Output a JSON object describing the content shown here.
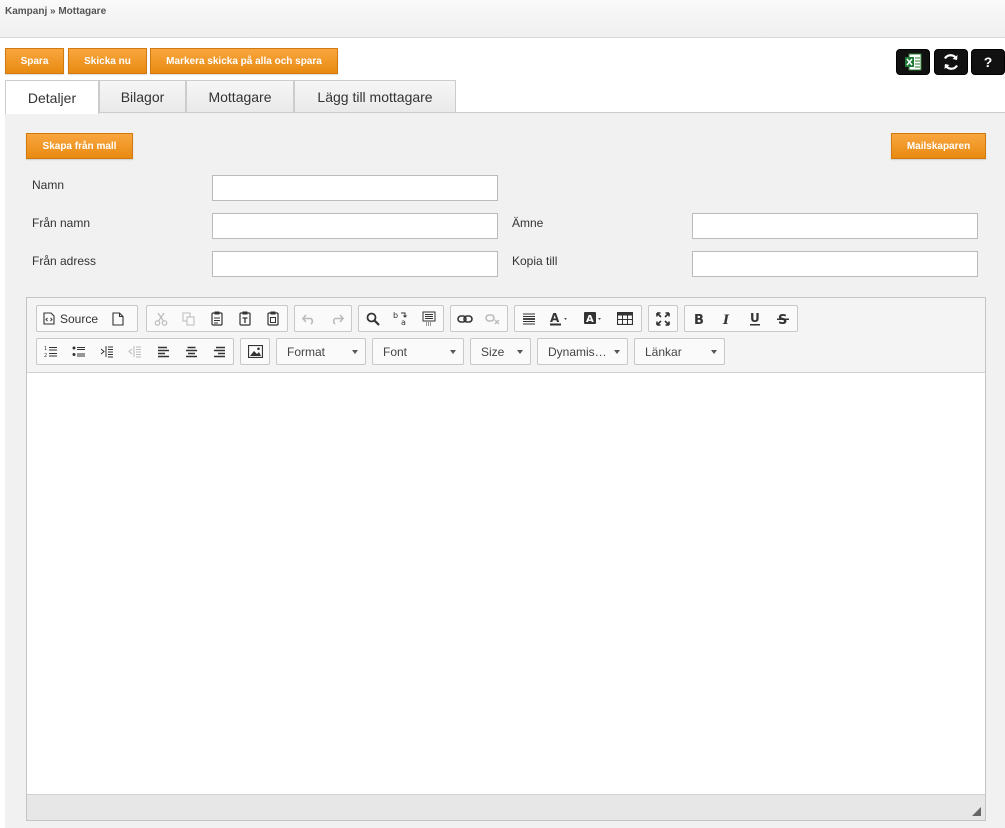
{
  "breadcrumb": "Kampanj » Mottagare",
  "actions": {
    "save": "Spara",
    "send_now": "Skicka nu",
    "mark_send_all": "Markera skicka på alla och spara"
  },
  "tools": {
    "help": "?"
  },
  "tabs": [
    {
      "label": "Detaljer",
      "active": true
    },
    {
      "label": "Bilagor"
    },
    {
      "label": "Mottagare"
    },
    {
      "label": "Lägg till mottagare"
    }
  ],
  "panel": {
    "create_from_template": "Skapa från mall",
    "mail_creator": "Mailskaparen"
  },
  "form": {
    "name_label": "Namn",
    "name_value": "",
    "from_name_label": "Från namn",
    "from_name_value": "",
    "subject_label": "Ämne",
    "subject_value": "",
    "from_address_label": "Från adress",
    "from_address_value": "",
    "copy_to_label": "Kopia till",
    "copy_to_value": ""
  },
  "editor": {
    "source_label": "Source",
    "combos": {
      "format": "Format",
      "font": "Font",
      "size": "Size",
      "dynamic": "Dynamis…",
      "links": "Länkar"
    }
  },
  "colors": {
    "accent_orange": "#f39a2b",
    "tool_black": "#111111"
  }
}
